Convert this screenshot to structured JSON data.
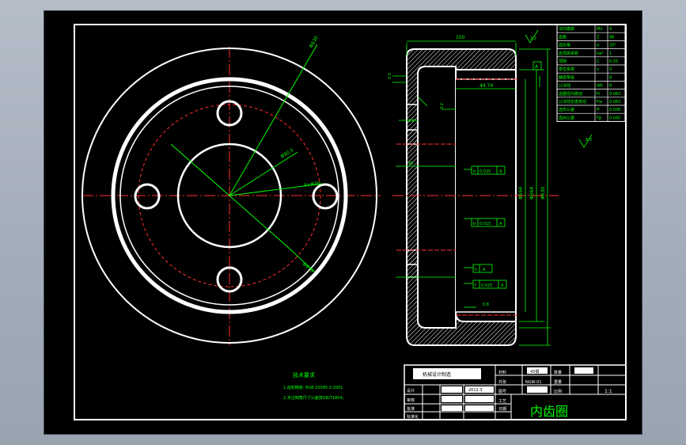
{
  "drawing": {
    "part_name": "内齿圈",
    "tech_title": "技术要求",
    "tech_notes": [
      "1.齿轮精度: 8GB 10095.2-2001",
      "2.未注倒角尺寸公差按GB/T1804。"
    ]
  },
  "dimensions": {
    "overall_width": "150",
    "thickness_callout": "44.74",
    "left_small": "2.5",
    "mid_small_a": "1.6",
    "mid_small_b": "3.2",
    "step": "95",
    "bottom_small": "0.8",
    "top_roughness": "3.2",
    "dia_a": "Φ594",
    "dia_b": "Φ564",
    "dia_c": "Φ630",
    "front_r1": "Φ630",
    "front_r2": "Φ90.5",
    "front_r3": "4×Φ30",
    "front_r4": "Φ470",
    "general_roughness": "6.3"
  },
  "gdt": {
    "datum_a": "A",
    "frame1": [
      "b",
      "0.025",
      "A"
    ],
    "frame2": [
      "b",
      "0.015",
      "A"
    ],
    "frame3": [
      "h",
      "A"
    ],
    "frame4": [
      "f",
      "0.025",
      "A"
    ]
  },
  "param_table": [
    [
      "法向模数",
      "Mn",
      "4"
    ],
    [
      "齿数",
      "Z",
      "96"
    ],
    [
      "齿形角",
      "α",
      "20°"
    ],
    [
      "齿顶高系数",
      "ha*",
      "1"
    ],
    [
      "顶隙",
      "C",
      "0.25"
    ],
    [
      "变位系数",
      "x",
      "0"
    ],
    [
      "精度等级",
      "",
      "8"
    ],
    [
      "公法线",
      "Wk",
      "8"
    ],
    [
      "齿圈径向跳动",
      "Fr",
      "0.063"
    ],
    [
      "公法线长度变动",
      "Fw",
      "0.063"
    ],
    [
      "齿形公差",
      "ff",
      "0.036"
    ],
    [
      "齿向公差",
      "Fβ",
      "0.045"
    ]
  ],
  "title_block": {
    "company": "机械设计制造",
    "material": "45钢",
    "qty_label": "数量",
    "weight_label": "重量",
    "scale_label": "比例",
    "scale": "1:1",
    "ratio_label": "材料",
    "sheet_label": "共张",
    "design_label": "设计",
    "check_label": "审核",
    "approve_label": "批准",
    "std_label": "标准化",
    "process_label": "工艺",
    "date_label": "日期",
    "drawing_no": "图号",
    "code": "NGW-01",
    "date": "2012.3"
  },
  "colors": {
    "background": "#000000",
    "outline": "#ffffff",
    "dimension": "#00ff00",
    "center": "#ff0000",
    "hatch": "#ffffff"
  }
}
